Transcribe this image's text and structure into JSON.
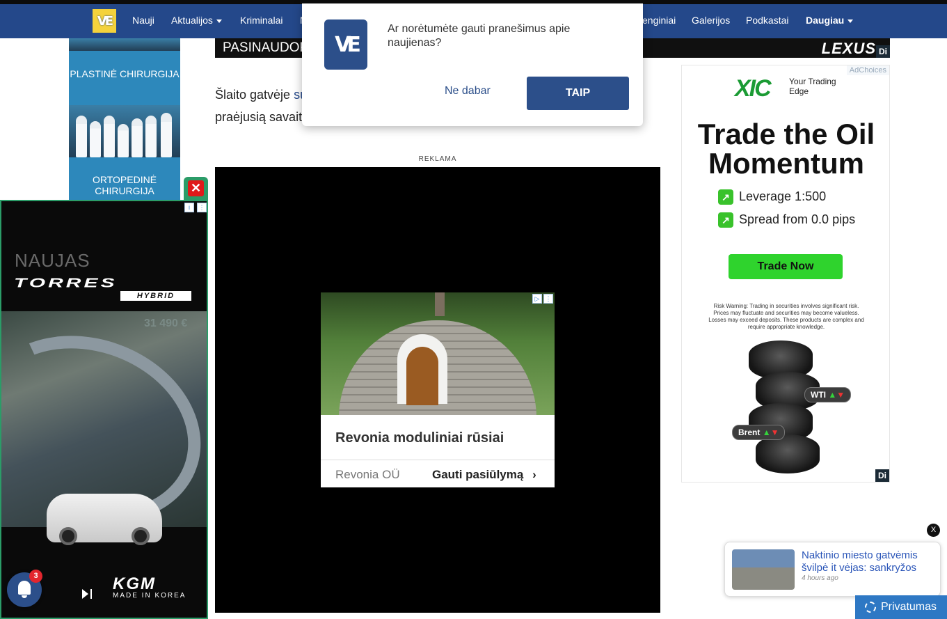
{
  "nav": {
    "items": [
      "Nauji",
      "Aktualijos",
      "Kriminalai",
      "N",
      "enginiai",
      "Galerijos",
      "Podkastai",
      "Daugiau"
    ],
    "logo_text": "VE"
  },
  "left_sky": {
    "label1": "PLASTINĖ CHIRURGIJA",
    "label2": "ORTOPEDINĖ CHIRURGIJA"
  },
  "banner_top": {
    "text": "PASINAUDOK",
    "brand": "LEXUS",
    "badge": "Di"
  },
  "article": {
    "before_link": "Šlaito gatvėje ",
    "link": "su",
    "line2": "praėjusią savait"
  },
  "reklama": "REKLAMA",
  "native_ad": {
    "title": "Revonia moduliniai rūsiai",
    "advertiser": "Revonia OÜ",
    "cta": "Gauti pasiūlymą",
    "cta_icon": "chevron-right-icon"
  },
  "right_ad": {
    "adchoices": "AdChoices",
    "logo": "XIC",
    "tagline": "Your Trading Edge",
    "headline": "Trade the Oil Momentum",
    "bullet1": "Leverage 1:500",
    "bullet2": "Spread from 0.0 pips",
    "button": "Trade Now",
    "risk": "Risk Warning: Trading in securities involves significant risk. Prices may fluctuate and securities may become valueless. Losses may exceed deposits. These products are complex and require appropriate knowledge.",
    "wti": "WTI",
    "brent": "Brent",
    "badge": "Di"
  },
  "left_ad": {
    "close": "✕",
    "naujas": "NAUJAS",
    "model": "TORRES",
    "hybrid": "HYBRID",
    "price": "31 490 €",
    "brand": "KGM",
    "made_in": "MADE IN KOREA"
  },
  "bell": {
    "count": "3"
  },
  "prompt": {
    "question": "Ar norėtumėte gauti pranešimus apie naujienas?",
    "no": "Ne dabar",
    "yes": "TAIP"
  },
  "recommendation": {
    "title": "Naktinio miesto gatvėmis švilpė it vėjas: sankryžos",
    "time": "4 hours ago",
    "close": "X"
  },
  "privacy": {
    "label": "Privatumas"
  }
}
